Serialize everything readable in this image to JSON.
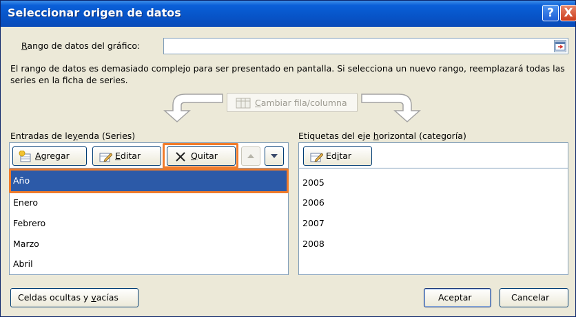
{
  "window": {
    "title": "Seleccionar origen de datos",
    "help_label": "?",
    "close_label": "X"
  },
  "range": {
    "label_pre": "",
    "label_u": "R",
    "label_post": "ango de datos del gráfico:",
    "value": ""
  },
  "note": "El rango de datos es demasiado complejo para ser presentado en pantalla. Si selecciona un nuevo rango, reemplazará todas las series en la ficha de series.",
  "swap": {
    "label_u": "C",
    "label_post": "ambiar fila/columna"
  },
  "legend_panel": {
    "title_pre": "Entradas de le",
    "title_u": "y",
    "title_post": "enda (Series)",
    "add_u": "A",
    "add_post": "gregar",
    "edit_u": "E",
    "edit_post": "ditar",
    "remove_u": "Q",
    "remove_post": "uitar",
    "items": [
      "Año",
      "Enero",
      "Febrero",
      "Marzo",
      "Abril"
    ],
    "selected": "Año"
  },
  "axis_panel": {
    "title_pre": "Etiquetas del eje ",
    "title_u": "h",
    "title_post": "orizontal (categoría)",
    "edit_pre": "Ed",
    "edit_u": "i",
    "edit_post": "tar",
    "items": [
      "2005",
      "2006",
      "2007",
      "2008"
    ]
  },
  "footer": {
    "hidden_pre": "Celdas ocultas y ",
    "hidden_u": "v",
    "hidden_post": "acías",
    "ok_label": "Aceptar",
    "cancel_label": "Cancelar"
  },
  "colors": {
    "title_bar": "#0754c8",
    "selection": "#2c5aa8",
    "highlight": "#f07b2a"
  }
}
